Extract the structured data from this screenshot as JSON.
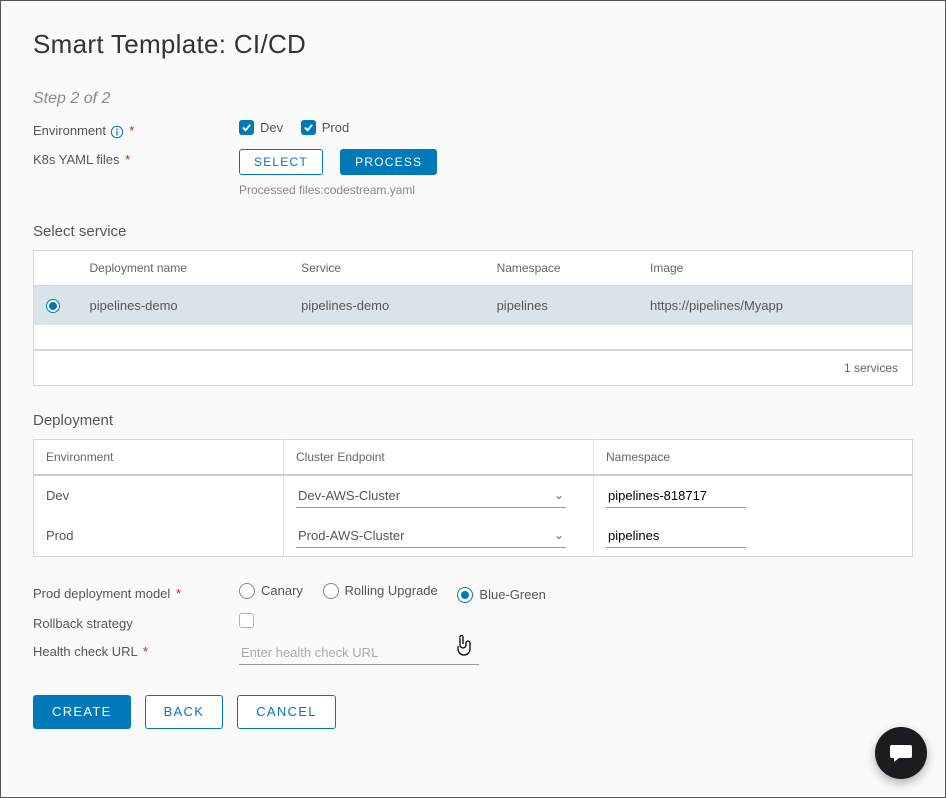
{
  "title": "Smart Template: CI/CD",
  "step": "Step 2 of 2",
  "labels": {
    "environment": "Environment",
    "k8s": "K8s YAML files",
    "processed_prefix": "Processed files:",
    "processed_file": "codestream.yaml",
    "select": "SELECT",
    "process": "PROCESS",
    "select_service": "Select service",
    "deployment": "Deployment",
    "prod_model": "Prod deployment model",
    "rollback": "Rollback strategy",
    "health": "Health check URL",
    "health_placeholder": "Enter health check URL",
    "create": "CREATE",
    "back": "BACK",
    "cancel": "CANCEL",
    "services_count": "1 services"
  },
  "env_options": {
    "dev": "Dev",
    "prod": "Prod"
  },
  "service_table": {
    "cols": {
      "name": "Deployment name",
      "service": "Service",
      "ns": "Namespace",
      "image": "Image"
    },
    "row": {
      "name": "pipelines-demo",
      "service": "pipelines-demo",
      "ns": "pipelines",
      "image": "https://pipelines/Myapp"
    }
  },
  "deploy_table": {
    "cols": {
      "env": "Environment",
      "cluster": "Cluster Endpoint",
      "ns": "Namespace"
    },
    "rows": [
      {
        "env": "Dev",
        "cluster": "Dev-AWS-Cluster",
        "ns": "pipelines-818717"
      },
      {
        "env": "Prod",
        "cluster": "Prod-AWS-Cluster",
        "ns": "pipelines"
      }
    ]
  },
  "models": {
    "canary": "Canary",
    "rolling": "Rolling Upgrade",
    "bluegreen": "Blue-Green"
  }
}
